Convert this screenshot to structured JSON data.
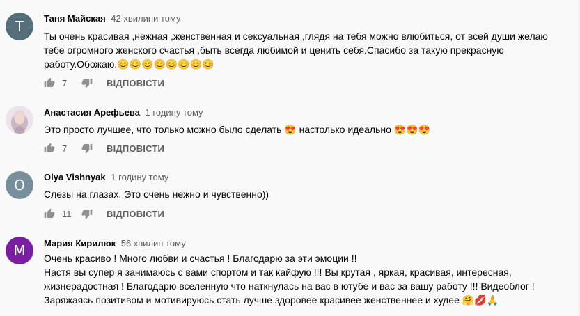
{
  "comments": [
    {
      "author": "Таня Майская",
      "time": "42 хвилини тому",
      "avatar_letter": "T",
      "avatar_color": "#546e7a",
      "lines": [
        "Ты очень красивая ,нежная ,женственная и сексуальная ,глядя на тебя можно влюбиться, от всей души желаю",
        "тебе огромного женского счастья ,быть всегда любимой и ценить себя.Спасибо за такую прекрасную",
        "работу.Обожаю.😊😊😊😊😊😊😊😊"
      ],
      "likes": "7",
      "reply_label": "ВІДПОВІСТИ"
    },
    {
      "author": "Анастасия Арефьева",
      "time": "1 годину тому",
      "avatar_letter": "",
      "avatar_color": "#d8c4d6",
      "lines": [
        "Это просто лучшее, что только можно было сделать 😍  настолько идеально 😍😍😍"
      ],
      "likes": "7",
      "reply_label": "ВІДПОВІСТИ"
    },
    {
      "author": "Olya Vishnyak",
      "time": "1 годину тому",
      "avatar_letter": "O",
      "avatar_color": "#78909c",
      "lines": [
        "Слезы на глазах. Это очень нежно и чувственно))"
      ],
      "likes": "11",
      "reply_label": "ВІДПОВІСТИ"
    },
    {
      "author": "Мария Кирилюк",
      "time": "56 хвилин тому",
      "avatar_letter": "M",
      "avatar_color": "#7b1fa2",
      "lines": [
        "Очень красиво ! Много любви и счастья ! Благодарю за эти эмоции !!",
        "Настя вы супер я занимаюсь с вами спортом и так кайфую !!! Вы крутая , яркая, красивая, интересная,",
        "жизнерадостная ! Благодарю вселенную что наткнулась на вас в ютубе и вас за вашу работу !!! Видеоблог !",
        "Заряжаясь позитивом и мотивируюсь стать лучше здоровее красивее женственнее и худее 🤗💋🙏"
      ]
    }
  ]
}
